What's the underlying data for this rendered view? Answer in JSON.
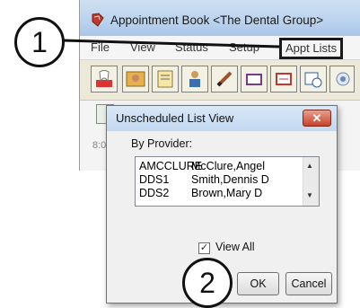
{
  "window": {
    "title": "Appointment Book <The Dental Group>",
    "menu": [
      "File",
      "View",
      "Status",
      "Setup",
      "Appt Lists"
    ]
  },
  "toolbar": {
    "icons": [
      "tooth-icon",
      "patient-photo-icon",
      "chart-icon",
      "provider-icon",
      "pencil-icon",
      "note-icon",
      "list-icon",
      "clock-icon",
      "pin-icon"
    ]
  },
  "row2": {
    "time_label": "8:0"
  },
  "dialog": {
    "title": "Unscheduled List View",
    "close_symbol": "✕",
    "by_provider_label": "By Provider:",
    "providers": [
      {
        "code": "AMCCLURE",
        "name": "McClure,Angel"
      },
      {
        "code": "DDS1",
        "name": "Smith,Dennis  D"
      },
      {
        "code": "DDS2",
        "name": "Brown,Mary  D"
      }
    ],
    "view_all_label": "View All",
    "view_all_checked": true,
    "ok_label": "OK",
    "cancel_label": "Cancel"
  },
  "callouts": {
    "one": "1",
    "two": "2"
  },
  "colors": {
    "titlebar": "#bcd4ee",
    "close": "#c8422b",
    "highlight": "#1a1a1a"
  }
}
